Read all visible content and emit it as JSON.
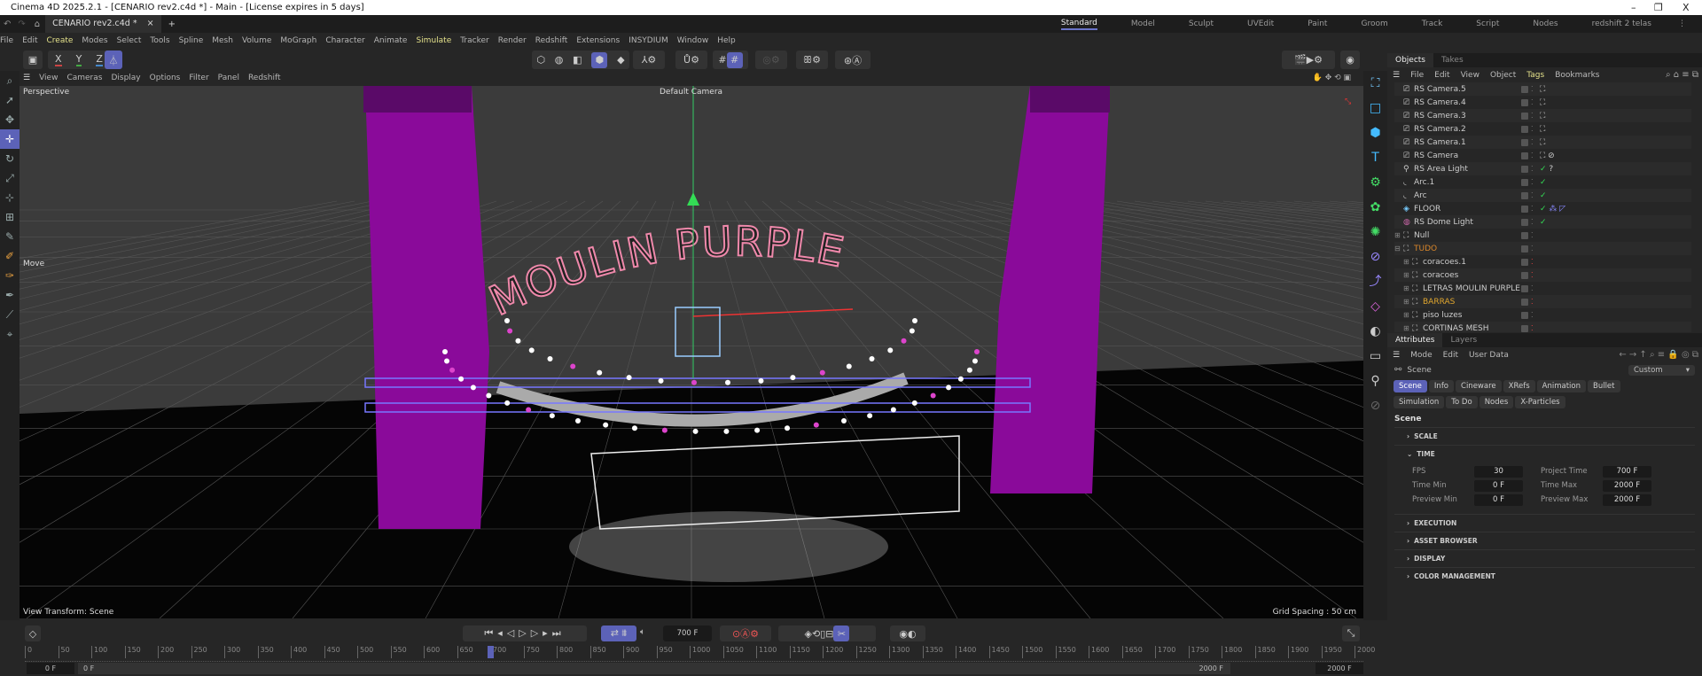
{
  "window": {
    "title": "Cinema 4D 2025.2.1 - [CENARIO rev2.c4d *] - Main - [License expires in 5 days]",
    "min": "–",
    "max": "❐",
    "close": "X"
  },
  "doc_tab": {
    "label": "CENARIO rev2.c4d *",
    "close": "×",
    "add": "+"
  },
  "layouts": [
    "Standard",
    "Model",
    "Sculpt",
    "UVEdit",
    "Paint",
    "Groom",
    "Track",
    "Script",
    "Nodes",
    "redshift 2 telas"
  ],
  "menu": [
    "File",
    "Edit",
    "Create",
    "Modes",
    "Select",
    "Tools",
    "Spline",
    "Mesh",
    "Volume",
    "MoGraph",
    "Character",
    "Animate",
    "Simulate",
    "Tracker",
    "Render",
    "Redshift",
    "Extensions",
    "INSYDIUM",
    "Window",
    "Help"
  ],
  "axis_buttons": [
    "X",
    "Y",
    "Z"
  ],
  "viewport": {
    "menu": [
      "View",
      "Cameras",
      "Display",
      "Options",
      "Filter",
      "Panel",
      "Redshift"
    ],
    "projection": "Perspective",
    "camera": "Default Camera",
    "tool": "Move",
    "view_transform": "View Transform: Scene",
    "grid_spacing": "Grid Spacing : 50 cm",
    "scene_text": "MOULIN PURPLE",
    "curtain_color": "#8a0a9a"
  },
  "objects": {
    "tabs": [
      "Objects",
      "Takes"
    ],
    "menu": [
      "File",
      "Edit",
      "View",
      "Object",
      "Tags",
      "Bookmarks"
    ],
    "items": [
      {
        "name": "RS Camera.5",
        "icon": "camera-icon",
        "tag": "⛶",
        "indent": 0
      },
      {
        "name": "RS Camera.4",
        "icon": "camera-icon",
        "tag": "⛶",
        "indent": 0
      },
      {
        "name": "RS Camera.3",
        "icon": "camera-icon",
        "tag": "⛶",
        "indent": 0
      },
      {
        "name": "RS Camera.2",
        "icon": "camera-icon",
        "tag": "⛶",
        "indent": 0
      },
      {
        "name": "RS Camera.1",
        "icon": "camera-icon",
        "tag": "⛶",
        "indent": 0
      },
      {
        "name": "RS Camera",
        "icon": "camera-icon",
        "tag": "⛶ ⊘",
        "indent": 0
      },
      {
        "name": "RS Area Light",
        "icon": "light-icon",
        "tag": "✓ ?",
        "indent": 0
      },
      {
        "name": "Arc.1",
        "icon": "arc-icon",
        "tag": "✓",
        "indent": 0
      },
      {
        "name": "Arc",
        "icon": "arc-icon",
        "tag": "✓",
        "indent": 0
      },
      {
        "name": "FLOOR",
        "icon": "floor-icon",
        "tag": "✓ ⁂ ◸",
        "indent": 0
      },
      {
        "name": "RS Dome Light",
        "icon": "dome-light-icon",
        "tag": "✓",
        "indent": 0
      },
      {
        "name": "Null",
        "icon": "null-icon",
        "tag": "",
        "indent": 0
      },
      {
        "name": "TUDO",
        "icon": "null-icon",
        "tag": "",
        "indent": 0,
        "color": "#d9862b"
      },
      {
        "name": "coracoes.1",
        "icon": "null-icon",
        "tag": "",
        "indent": 1,
        "red": true
      },
      {
        "name": "coracoes",
        "icon": "null-icon",
        "tag": "",
        "indent": 1,
        "red": true
      },
      {
        "name": "LETRAS MOULIN PURPLE",
        "icon": "null-icon",
        "tag": "",
        "indent": 1
      },
      {
        "name": "BARRAS",
        "icon": "null-icon",
        "tag": "",
        "indent": 1,
        "color": "#e0a62e",
        "red": true
      },
      {
        "name": "piso luzes",
        "icon": "null-icon",
        "tag": "",
        "indent": 1
      },
      {
        "name": "CORTINAS MESH",
        "icon": "null-icon",
        "tag": "",
        "indent": 1,
        "red": true
      }
    ]
  },
  "attributes": {
    "tabs": [
      "Attributes",
      "Layers"
    ],
    "menu": [
      "Mode",
      "Edit",
      "User Data"
    ],
    "object": "Scene",
    "preset": "Custom",
    "chips": [
      "Scene",
      "Info",
      "Cineware",
      "XRefs",
      "Animation",
      "Bullet",
      "Simulation",
      "To Do",
      "Nodes",
      "X-Particles"
    ],
    "heading": "Scene",
    "sections": [
      "SCALE",
      "TIME",
      "EXECUTION",
      "ASSET BROWSER",
      "DISPLAY",
      "COLOR MANAGEMENT"
    ],
    "time": {
      "fps_label": "FPS",
      "fps": "30",
      "project_time_label": "Project Time",
      "project_time": "700 F",
      "time_min_label": "Time Min",
      "time_min": "0 F",
      "time_max_label": "Time Max",
      "time_max": "2000 F",
      "preview_min_label": "Preview Min",
      "preview_min": "0 F",
      "preview_max_label": "Preview Max",
      "preview_max": "2000 F"
    }
  },
  "timeline": {
    "current_frame": "700 F",
    "ticks": [
      0,
      50,
      100,
      150,
      200,
      250,
      300,
      350,
      400,
      450,
      500,
      550,
      600,
      650,
      700,
      750,
      800,
      850,
      900,
      950,
      1000,
      1050,
      1100,
      1150,
      1200,
      1250,
      1300,
      1350,
      1400,
      1450,
      1500,
      1550,
      1600,
      1650,
      1700,
      1750,
      1800,
      1850,
      1900,
      1950,
      2000
    ],
    "playhead": 700,
    "start": "0 F",
    "start2": "0 F",
    "end": "2000 F",
    "end2": "2000 F"
  },
  "accent": "#5c62b8"
}
